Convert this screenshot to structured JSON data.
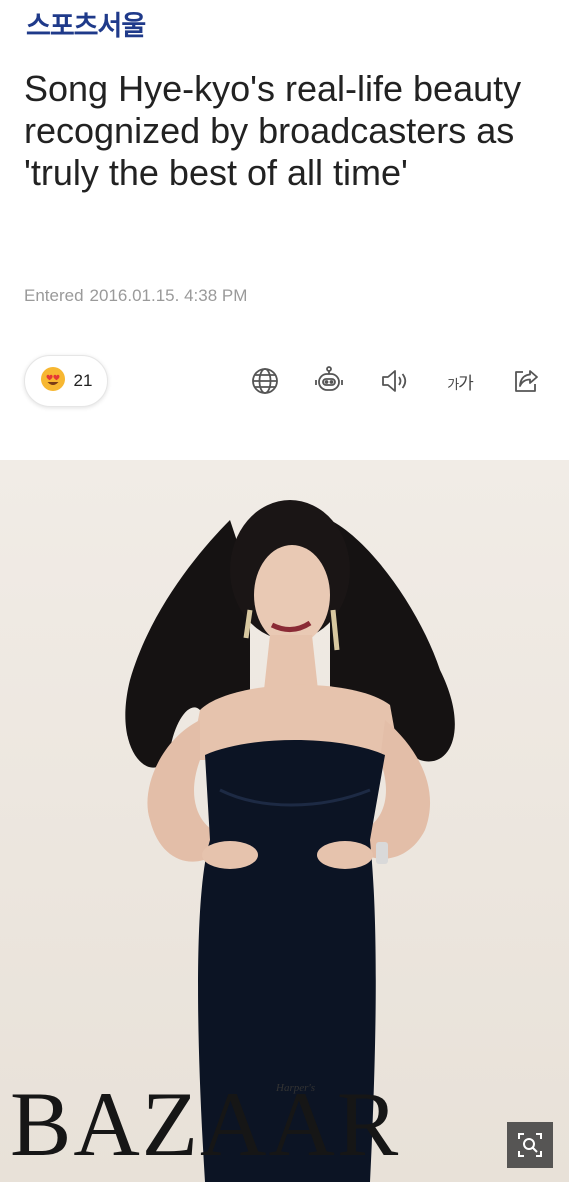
{
  "header": {
    "brand": "스포츠서울"
  },
  "article": {
    "title": "Song Hye-kyo's real-life beauty recognized by broadcasters as 'truly the best of all time'",
    "entered_label": "Entered",
    "entered_datetime": "2016.01.15. 4:38 PM"
  },
  "reactions": {
    "emoji": "heart-eyes-emoji",
    "count": "21"
  },
  "toolbar": {
    "items": [
      "globe-icon",
      "robot-icon",
      "speaker-icon",
      "font-size",
      "share-icon"
    ],
    "font_size_label_small": "가",
    "font_size_label_large": "가"
  },
  "photo": {
    "magazine_logo": "BAZAAR",
    "magazine_sub": "Harper's",
    "zoom_icon": "zoom-icon"
  },
  "colors": {
    "brand": "#1f3a8a",
    "meta_text": "#9a9a9a",
    "emoji_face": "#f7b731",
    "emoji_heart": "#e53935",
    "photo_bg": "#ece6df"
  }
}
